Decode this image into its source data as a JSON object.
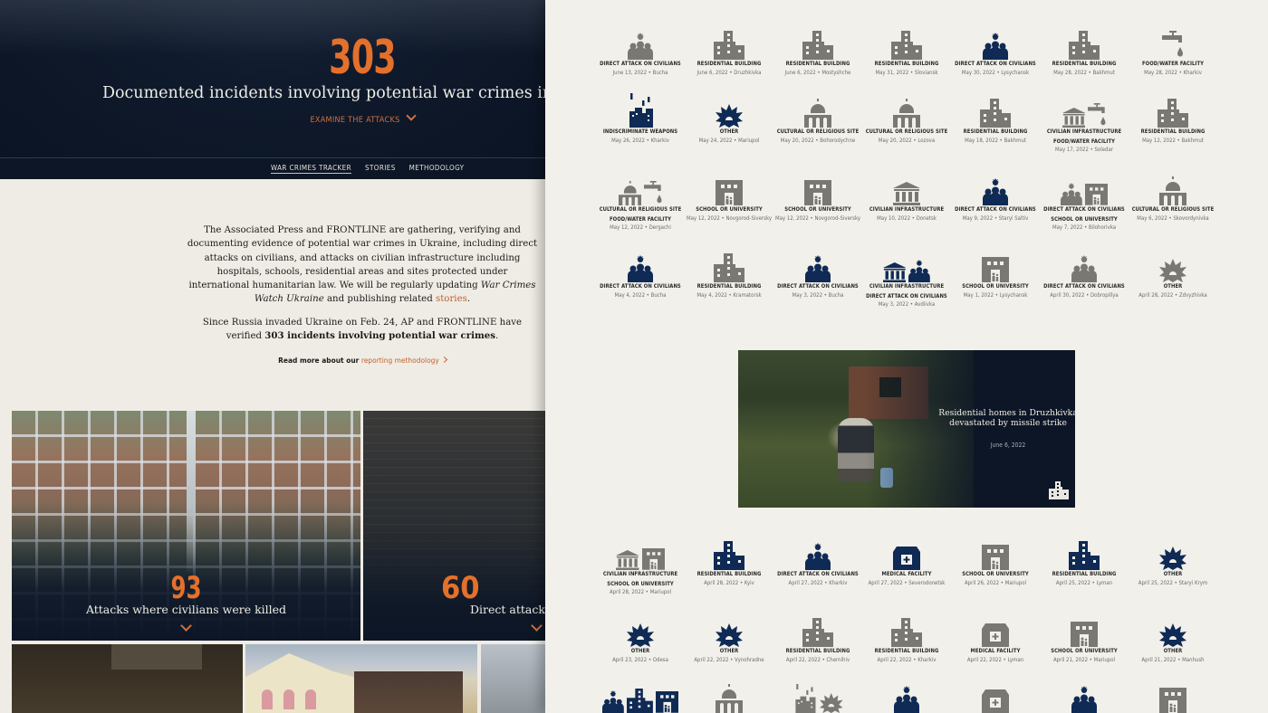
{
  "hero": {
    "count": "303",
    "subtitle": "Documented incidents involving potential war crimes in Ukraine",
    "cta": "EXAMINE THE ATTACKS"
  },
  "nav": {
    "items": [
      {
        "label": "WAR CRIMES TRACKER",
        "active": true
      },
      {
        "label": "STORIES",
        "active": false
      },
      {
        "label": "METHODOLOGY",
        "active": false
      }
    ]
  },
  "intro": {
    "p1_a": "The Associated Press and FRONTLINE are gathering, verifying and documenting evidence of potential war crimes in Ukraine, including direct attacks on civilians, and attacks on civilian infrastructure including hospitals, schools, residential areas and sites protected under international humanitarian law. We will be regularly updating ",
    "p1_em": "War Crimes Watch Ukraine",
    "p1_b": " and publishing related ",
    "p1_link": "stories",
    "p1_end": ".",
    "p2_a": "Since Russia invaded Ukraine on Feb. 24, AP and FRONTLINE have verified ",
    "p2_bold": "303 incidents involving potential war crimes",
    "p2_end": ".",
    "readmore_prefix": "Read more about our ",
    "readmore_link": "reporting methodology"
  },
  "cards": [
    {
      "count": "93",
      "title": "Attacks where civilians were killed"
    },
    {
      "count": "60",
      "title": "Direct attacks on civilians"
    }
  ],
  "colors": {
    "accent": "#e4702b",
    "navy": "#0c1626",
    "icon_navy": "#0f2a55",
    "icon_gray": "#7a7872"
  },
  "incidents": [
    {
      "types": [
        "DIRECT ATTACK ON CIVILIANS"
      ],
      "date": "June 13, 2022",
      "place": "Bucha",
      "icons": [
        "civilians"
      ],
      "color": "gray"
    },
    {
      "types": [
        "RESIDENTIAL BUILDING"
      ],
      "date": "June 6, 2022",
      "place": "Druzhkivka",
      "icons": [
        "residential"
      ],
      "color": "gray"
    },
    {
      "types": [
        "RESIDENTIAL BUILDING"
      ],
      "date": "June 6, 2022",
      "place": "Mostyshche",
      "icons": [
        "residential"
      ],
      "color": "gray"
    },
    {
      "types": [
        "RESIDENTIAL BUILDING"
      ],
      "date": "May 31, 2022",
      "place": "Sloviansk",
      "icons": [
        "residential"
      ],
      "color": "gray"
    },
    {
      "types": [
        "DIRECT ATTACK ON CIVILIANS"
      ],
      "date": "May 30, 2022",
      "place": "Lysychansk",
      "icons": [
        "civilians"
      ],
      "color": "navy"
    },
    {
      "types": [
        "RESIDENTIAL BUILDING"
      ],
      "date": "May 28, 2022",
      "place": "Bakhmut",
      "icons": [
        "residential"
      ],
      "color": "gray"
    },
    {
      "types": [
        "FOOD/WATER FACILITY"
      ],
      "date": "May 28, 2022",
      "place": "Kharkiv",
      "icons": [
        "water"
      ],
      "color": "gray"
    },
    {
      "types": [
        "INDISCRIMINATE WEAPONS"
      ],
      "date": "May 26, 2022",
      "place": "Kharkiv",
      "icons": [
        "weapons"
      ],
      "color": "navy"
    },
    {
      "types": [
        "OTHER"
      ],
      "date": "May 24, 2022",
      "place": "Mariupol",
      "icons": [
        "explosion"
      ],
      "color": "navy"
    },
    {
      "types": [
        "CULTURAL OR RELIGIOUS SITE"
      ],
      "date": "May 20, 2022",
      "place": "Bohorodychne",
      "icons": [
        "religious"
      ],
      "color": "gray"
    },
    {
      "types": [
        "CULTURAL OR RELIGIOUS SITE"
      ],
      "date": "May 20, 2022",
      "place": "Lozova",
      "icons": [
        "religious"
      ],
      "color": "gray"
    },
    {
      "types": [
        "RESIDENTIAL BUILDING"
      ],
      "date": "May 18, 2022",
      "place": "Bakhmut",
      "icons": [
        "residential"
      ],
      "color": "gray"
    },
    {
      "types": [
        "CIVILIAN INFRASTRUCTURE",
        "FOOD/WATER FACILITY"
      ],
      "date": "May 17, 2022",
      "place": "Soledar",
      "icons": [
        "infrastructure",
        "water"
      ],
      "color": "gray"
    },
    {
      "types": [
        "RESIDENTIAL BUILDING"
      ],
      "date": "May 12, 2022",
      "place": "Bakhmut",
      "icons": [
        "residential"
      ],
      "color": "gray"
    },
    {
      "types": [
        "CULTURAL OR RELIGIOUS SITE",
        "FOOD/WATER FACILITY"
      ],
      "date": "May 12, 2022",
      "place": "Dergachi",
      "icons": [
        "religious",
        "water"
      ],
      "color": "gray"
    },
    {
      "types": [
        "SCHOOL OR UNIVERSITY"
      ],
      "date": "May 12, 2022",
      "place": "Novgorod-Siversky",
      "icons": [
        "school"
      ],
      "color": "gray"
    },
    {
      "types": [
        "SCHOOL OR UNIVERSITY"
      ],
      "date": "May 12, 2022",
      "place": "Novgorod-Siversky",
      "icons": [
        "school"
      ],
      "color": "gray"
    },
    {
      "types": [
        "CIVILIAN INFRASTRUCTURE"
      ],
      "date": "May 10, 2022",
      "place": "Donetsk",
      "icons": [
        "infrastructure"
      ],
      "color": "gray"
    },
    {
      "types": [
        "DIRECT ATTACK ON CIVILIANS"
      ],
      "date": "May 9, 2022",
      "place": "Staryi Saltiv",
      "icons": [
        "civilians"
      ],
      "color": "navy"
    },
    {
      "types": [
        "DIRECT ATTACK ON CIVILIANS",
        "SCHOOL OR UNIVERSITY"
      ],
      "date": "May 7, 2022",
      "place": "Bilohorivka",
      "icons": [
        "civilians",
        "school"
      ],
      "color": "gray"
    },
    {
      "types": [
        "CULTURAL OR RELIGIOUS SITE"
      ],
      "date": "May 6, 2022",
      "place": "Skovordynivka",
      "icons": [
        "religious"
      ],
      "color": "gray"
    },
    {
      "types": [
        "DIRECT ATTACK ON CIVILIANS"
      ],
      "date": "May 4, 2022",
      "place": "Bucha",
      "icons": [
        "civilians"
      ],
      "color": "navy"
    },
    {
      "types": [
        "RESIDENTIAL BUILDING"
      ],
      "date": "May 4, 2022",
      "place": "Kramatorsk",
      "icons": [
        "residential"
      ],
      "color": "gray"
    },
    {
      "types": [
        "DIRECT ATTACK ON CIVILIANS"
      ],
      "date": "May 3, 2022",
      "place": "Bucha",
      "icons": [
        "civilians"
      ],
      "color": "navy"
    },
    {
      "types": [
        "CIVILIAN INFRASTRUCTURE",
        "DIRECT ATTACK ON CIVILIANS"
      ],
      "date": "May 3, 2022",
      "place": "Avdiivka",
      "icons": [
        "infrastructure",
        "civilians"
      ],
      "color": "navy"
    },
    {
      "types": [
        "SCHOOL OR UNIVERSITY"
      ],
      "date": "May 1, 2022",
      "place": "Lysychansk",
      "icons": [
        "school"
      ],
      "color": "gray"
    },
    {
      "types": [
        "DIRECT ATTACK ON CIVILIANS"
      ],
      "date": "April 30, 2022",
      "place": "Dobropillya",
      "icons": [
        "civilians"
      ],
      "color": "gray"
    },
    {
      "types": [
        "OTHER"
      ],
      "date": "April 28, 2022",
      "place": "Zdvyzhivka",
      "icons": [
        "explosion"
      ],
      "color": "gray"
    },
    {
      "types": [
        "CIVILIAN INFRASTRUCTURE",
        "SCHOOL OR UNIVERSITY"
      ],
      "date": "April 28, 2022",
      "place": "Mariupol",
      "icons": [
        "infrastructure",
        "school"
      ],
      "color": "gray"
    },
    {
      "types": [
        "RESIDENTIAL BUILDING"
      ],
      "date": "April 28, 2022",
      "place": "Kyiv",
      "icons": [
        "residential"
      ],
      "color": "navy"
    },
    {
      "types": [
        "DIRECT ATTACK ON CIVILIANS"
      ],
      "date": "April 27, 2022",
      "place": "Kharkiv",
      "icons": [
        "civilians"
      ],
      "color": "navy"
    },
    {
      "types": [
        "MEDICAL FACILITY"
      ],
      "date": "April 27, 2022",
      "place": "Severodonetsk",
      "icons": [
        "medical"
      ],
      "color": "navy"
    },
    {
      "types": [
        "SCHOOL OR UNIVERSITY"
      ],
      "date": "April 26, 2022",
      "place": "Mariupol",
      "icons": [
        "school"
      ],
      "color": "gray"
    },
    {
      "types": [
        "RESIDENTIAL BUILDING"
      ],
      "date": "April 25, 2022",
      "place": "Lyman",
      "icons": [
        "residential"
      ],
      "color": "navy"
    },
    {
      "types": [
        "OTHER"
      ],
      "date": "April 25, 2022",
      "place": "Staryi Krym",
      "icons": [
        "explosion"
      ],
      "color": "navy"
    },
    {
      "types": [
        "OTHER"
      ],
      "date": "April 23, 2022",
      "place": "Odesa",
      "icons": [
        "explosion"
      ],
      "color": "navy"
    },
    {
      "types": [
        "OTHER"
      ],
      "date": "April 22, 2022",
      "place": "Vynohradne",
      "icons": [
        "explosion"
      ],
      "color": "navy"
    },
    {
      "types": [
        "RESIDENTIAL BUILDING"
      ],
      "date": "April 22, 2022",
      "place": "Chernihiv",
      "icons": [
        "residential"
      ],
      "color": "gray"
    },
    {
      "types": [
        "RESIDENTIAL BUILDING"
      ],
      "date": "April 22, 2022",
      "place": "Kharkiv",
      "icons": [
        "residential"
      ],
      "color": "gray"
    },
    {
      "types": [
        "MEDICAL FACILITY"
      ],
      "date": "April 22, 2022",
      "place": "Lyman",
      "icons": [
        "medical"
      ],
      "color": "gray"
    },
    {
      "types": [
        "SCHOOL OR UNIVERSITY"
      ],
      "date": "April 21, 2022",
      "place": "Mariupol",
      "icons": [
        "school"
      ],
      "color": "gray"
    },
    {
      "types": [
        "OTHER"
      ],
      "date": "April 21, 2022",
      "place": "Manhush",
      "icons": [
        "explosion"
      ],
      "color": "navy"
    },
    {
      "types": [],
      "date": "",
      "place": "",
      "icons": [
        "civilians",
        "residential",
        "school"
      ],
      "color": "navy"
    },
    {
      "types": [],
      "date": "",
      "place": "",
      "icons": [
        "religious"
      ],
      "color": "gray"
    },
    {
      "types": [],
      "date": "",
      "place": "",
      "icons": [
        "weapons",
        "explosion"
      ],
      "color": "gray"
    },
    {
      "types": [],
      "date": "",
      "place": "",
      "icons": [
        "civilians"
      ],
      "color": "navy"
    },
    {
      "types": [],
      "date": "",
      "place": "",
      "icons": [
        "medical"
      ],
      "color": "gray"
    },
    {
      "types": [],
      "date": "",
      "place": "",
      "icons": [
        "civilians"
      ],
      "color": "navy"
    },
    {
      "types": [],
      "date": "",
      "place": "",
      "icons": [
        "school"
      ],
      "color": "gray"
    }
  ],
  "feature": {
    "title": "Residential homes in Druzhkivka devastated by missile strike",
    "date": "June 6, 2022",
    "icon": "residential"
  }
}
